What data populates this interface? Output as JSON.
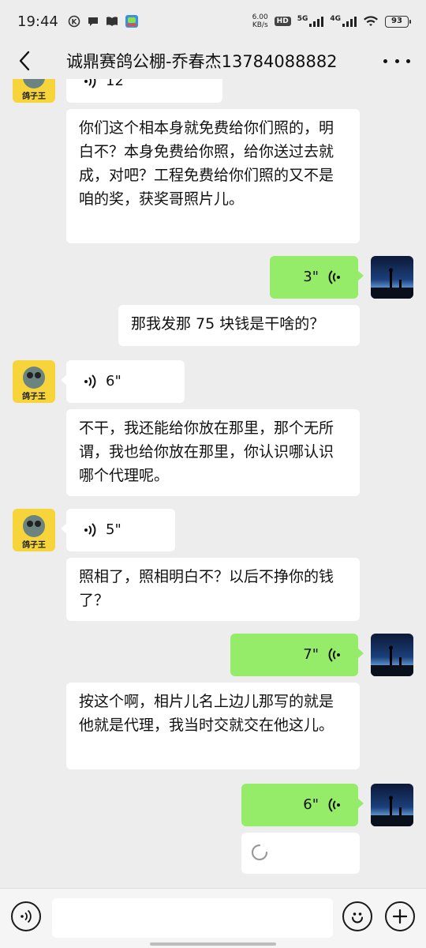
{
  "status_bar": {
    "time": "19:44",
    "net_speed_value": "6.00",
    "net_speed_unit": "KB/s",
    "hd_label": "HD",
    "sim1_label": "5G",
    "sim2_label": "4G",
    "battery": "93"
  },
  "header": {
    "title": "诚鼎赛鸽公棚-乔春杰13784088882"
  },
  "avatar_label": "鸽子王",
  "messages": [
    {
      "type": "voice",
      "side": "in",
      "duration": "12\""
    },
    {
      "type": "text",
      "side": "in",
      "text": "你们这个相本身就免费给你们照的，明白不？本身免费给你照，给你送过去就成，对吧？工程免费给你们照的又不是咱的奖，获奖哥照片儿。"
    },
    {
      "type": "voice",
      "side": "out",
      "duration": "3\""
    },
    {
      "type": "text",
      "side": "out-white",
      "text": "那我发那 75 块钱是干啥的？"
    },
    {
      "type": "voice",
      "side": "in",
      "duration": "6\""
    },
    {
      "type": "text",
      "side": "in",
      "text": "不干，我还能给你放在那里，那个无所谓，我也给你放在那里，你认识哪认识哪个代理呢。"
    },
    {
      "type": "voice",
      "side": "in",
      "duration": "5\""
    },
    {
      "type": "text",
      "side": "in",
      "text": "照相了，照相明白不？以后不挣你的钱了？"
    },
    {
      "type": "voice",
      "side": "out",
      "duration": "7\""
    },
    {
      "type": "text",
      "side": "in",
      "text": "按这个啊，相片儿名上边儿那写的就是他就是代理，我当时交就交在他这儿。"
    },
    {
      "type": "voice",
      "side": "out",
      "duration": "6\""
    },
    {
      "type": "loading",
      "side": "out"
    }
  ],
  "icons": {
    "back": "back-arrow-icon",
    "more": "more-dots-icon",
    "voice_toggle": "voice-mode-icon",
    "emoji": "emoji-icon",
    "plus": "plus-icon"
  }
}
